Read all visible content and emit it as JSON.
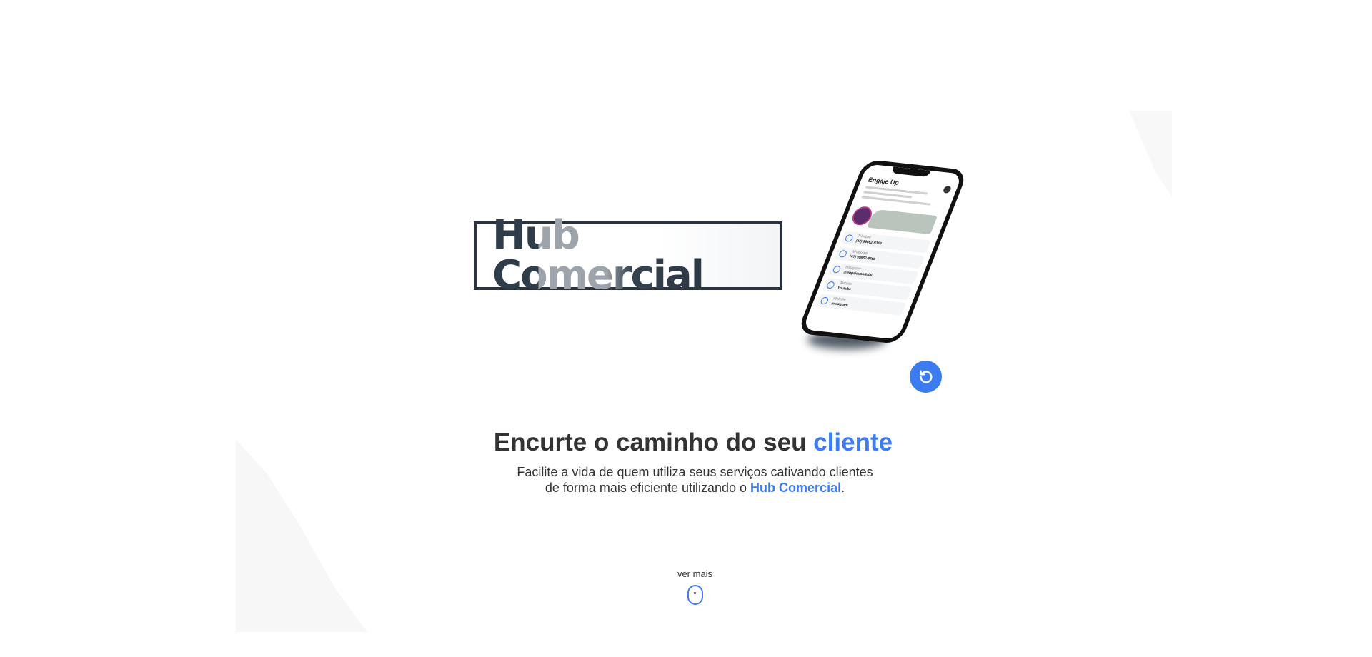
{
  "brand": {
    "logo_text": "Hub Comercial"
  },
  "phone_preview": {
    "profile_name": "Engaje Up",
    "rows": [
      {
        "label": "Telefone",
        "value": "(47) 99662-9369"
      },
      {
        "label": "WhatsApp",
        "value": "(47) 99662-9369"
      },
      {
        "label": "Instagram",
        "value": "@engajeupoficial"
      },
      {
        "label": "Website",
        "value": "Youtube"
      },
      {
        "label": "Website",
        "value": "Instagram"
      }
    ],
    "icon": "phone-mockup-icon"
  },
  "replay_button": {
    "icon": "replay-icon",
    "color": "#3d7cf0"
  },
  "hero": {
    "title_main": "Encurte o caminho do seu ",
    "title_accent": "cliente",
    "subtitle_line1": "Facilite a vida de quem utiliza seus serviços cativando clientes",
    "subtitle_line2_prefix": "de forma mais eficiente utilizando o ",
    "subtitle_brand": "Hub Comercial",
    "subtitle_suffix": "."
  },
  "scroll_hint": {
    "label": "ver mais",
    "icon": "mouse-scroll-icon"
  },
  "colors": {
    "accent": "#3d7cf0",
    "text": "#333333"
  }
}
